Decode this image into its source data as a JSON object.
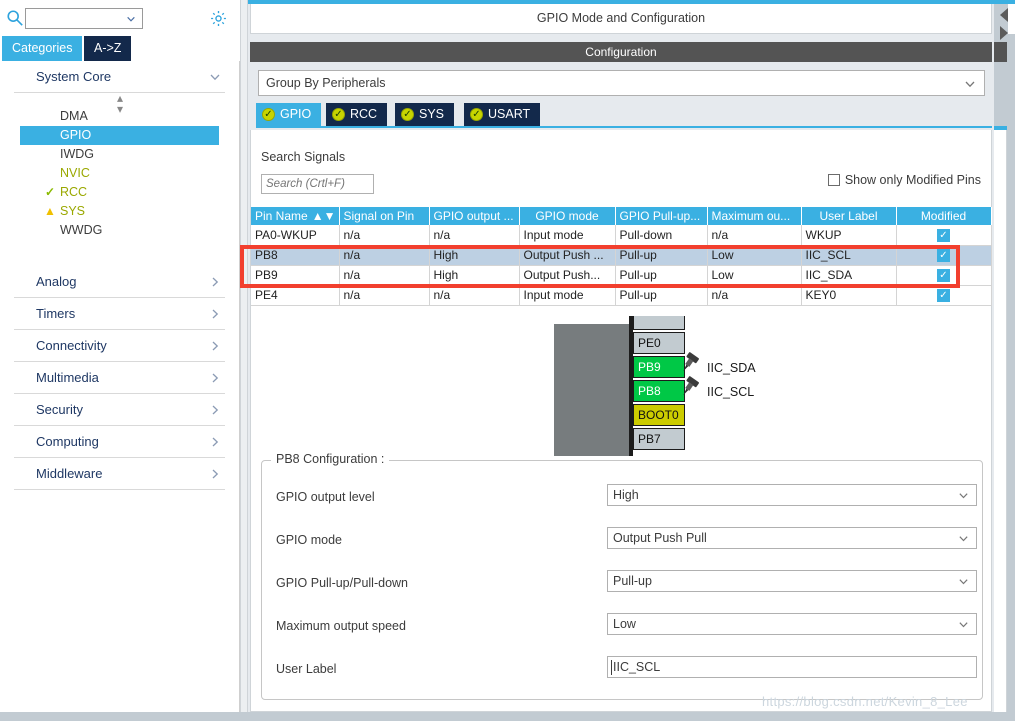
{
  "left_panel": {
    "search": {
      "value": "",
      "icon": "search-icon"
    },
    "settings_icon": "gear-icon",
    "tabs": [
      {
        "label": "Categories",
        "active": true
      },
      {
        "label": "A->Z",
        "active": false
      }
    ],
    "groups": [
      {
        "label": "System Core",
        "expanded": true,
        "items": [
          {
            "label": "DMA",
            "state": "none",
            "selected": false
          },
          {
            "label": "GPIO",
            "state": "none",
            "selected": true
          },
          {
            "label": "IWDG",
            "state": "none",
            "selected": false
          },
          {
            "label": "NVIC",
            "state": "modified",
            "selected": false
          },
          {
            "label": "RCC",
            "state": "ok",
            "selected": false
          },
          {
            "label": "SYS",
            "state": "warning",
            "selected": false
          },
          {
            "label": "WWDG",
            "state": "none",
            "selected": false
          }
        ]
      },
      {
        "label": "Analog",
        "expanded": false,
        "items": []
      },
      {
        "label": "Timers",
        "expanded": false,
        "items": []
      },
      {
        "label": "Connectivity",
        "expanded": false,
        "items": []
      },
      {
        "label": "Multimedia",
        "expanded": false,
        "items": []
      },
      {
        "label": "Security",
        "expanded": false,
        "items": []
      },
      {
        "label": "Computing",
        "expanded": false,
        "items": []
      },
      {
        "label": "Middleware",
        "expanded": false,
        "items": []
      }
    ]
  },
  "right_panel": {
    "mode_title": "GPIO Mode and Configuration",
    "config_header": "Configuration",
    "group_by": {
      "value": "Group By Peripherals"
    },
    "peripheral_tabs": [
      {
        "label": "GPIO",
        "active": true
      },
      {
        "label": "RCC",
        "active": false
      },
      {
        "label": "SYS",
        "active": false
      },
      {
        "label": "USART",
        "active": false
      }
    ],
    "search_signals": {
      "label": "Search Signals",
      "placeholder": "Search (Crtl+F)",
      "value": ""
    },
    "show_only_modified": {
      "label": "Show only Modified Pins",
      "checked": false
    },
    "table": {
      "columns": [
        "Pin Name",
        "Signal on Pin",
        "GPIO output ...",
        "GPIO mode",
        "GPIO Pull-up...",
        "Maximum ou...",
        "User Label",
        "Modified"
      ],
      "sort_column": "Pin Name",
      "rows": [
        {
          "pin_name": "PA0-WKUP",
          "signal": "n/a",
          "output_level": "n/a",
          "mode": "Input mode",
          "pull": "Pull-down",
          "speed": "n/a",
          "user_label": "WKUP",
          "modified": true,
          "selected": false,
          "highlighted": false
        },
        {
          "pin_name": "PB8",
          "signal": "n/a",
          "output_level": "High",
          "mode": "Output Push ...",
          "pull": "Pull-up",
          "speed": "Low",
          "user_label": "IIC_SCL",
          "modified": true,
          "selected": true,
          "highlighted": true
        },
        {
          "pin_name": "PB9",
          "signal": "n/a",
          "output_level": "High",
          "mode": "Output Push...",
          "pull": "Pull-up",
          "speed": "Low",
          "user_label": "IIC_SDA",
          "modified": true,
          "selected": false,
          "highlighted": true
        },
        {
          "pin_name": "PE4",
          "signal": "n/a",
          "output_level": "n/a",
          "mode": "Input mode",
          "pull": "Pull-up",
          "speed": "n/a",
          "user_label": "KEY0",
          "modified": true,
          "selected": false,
          "highlighted": false
        }
      ]
    },
    "chip_diagram": {
      "pins": [
        {
          "name": "",
          "color": "gray",
          "label": ""
        },
        {
          "name": "PE0",
          "color": "gray",
          "label": ""
        },
        {
          "name": "PB9",
          "color": "green",
          "label": "IIC_SDA"
        },
        {
          "name": "PB8",
          "color": "green",
          "label": "IIC_SCL"
        },
        {
          "name": "BOOT0",
          "color": "yellow",
          "label": ""
        },
        {
          "name": "PB7",
          "color": "gray",
          "label": ""
        }
      ]
    },
    "pin_config": {
      "title": "PB8 Configuration :",
      "fields": [
        {
          "label": "GPIO output level",
          "value": "High",
          "type": "select"
        },
        {
          "label": "GPIO mode",
          "value": "Output Push Pull",
          "type": "select"
        },
        {
          "label": "GPIO Pull-up/Pull-down",
          "value": "Pull-up",
          "type": "select"
        },
        {
          "label": "Maximum output speed",
          "value": "Low",
          "type": "select"
        },
        {
          "label": "User Label",
          "value": "IIC_SCL",
          "type": "text"
        }
      ]
    }
  },
  "watermark": "https://blog.csdn.net/Kevin_8_Lee",
  "colors": {
    "accent_blue": "#3ab0e2",
    "dark_navy": "#13294b",
    "highlight_red": "#f23f2e",
    "pin_green": "#00c846",
    "pin_yellow": "#cccc00",
    "row_selected": "#bdd0e3"
  }
}
